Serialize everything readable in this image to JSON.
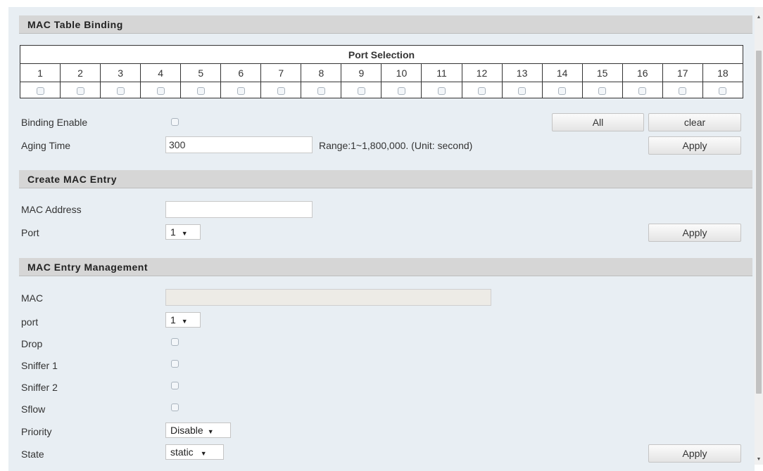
{
  "sections": {
    "mac_table_binding": "MAC Table Binding",
    "create_mac_entry": "Create MAC Entry",
    "mac_entry_management": "MAC Entry Management"
  },
  "port_selection": {
    "header": "Port Selection",
    "ports": [
      "1",
      "2",
      "3",
      "4",
      "5",
      "6",
      "7",
      "8",
      "9",
      "10",
      "11",
      "12",
      "13",
      "14",
      "15",
      "16",
      "17",
      "18"
    ]
  },
  "binding": {
    "binding_enable_label": "Binding Enable",
    "aging_time_label": "Aging Time",
    "aging_time_value": "300",
    "range_text": "Range:1~1,800,000. (Unit: second)",
    "all_button": "All",
    "clear_button": "clear",
    "apply_button": "Apply"
  },
  "create_entry": {
    "mac_address_label": "MAC Address",
    "mac_address_value": "",
    "port_label": "Port",
    "port_value": "1",
    "apply_button": "Apply"
  },
  "management": {
    "mac_label": "MAC",
    "mac_value": "",
    "port_label": "port",
    "port_value": "1",
    "drop_label": "Drop",
    "sniffer1_label": "Sniffer 1",
    "sniffer2_label": "Sniffer 2",
    "sflow_label": "Sflow",
    "priority_label": "Priority",
    "priority_value": "Disable",
    "state_label": "State",
    "state_value": "static",
    "apply_button": "Apply"
  },
  "colors": {
    "panel_bg": "#e8eef3",
    "header_bg": "#d6d6d6"
  }
}
